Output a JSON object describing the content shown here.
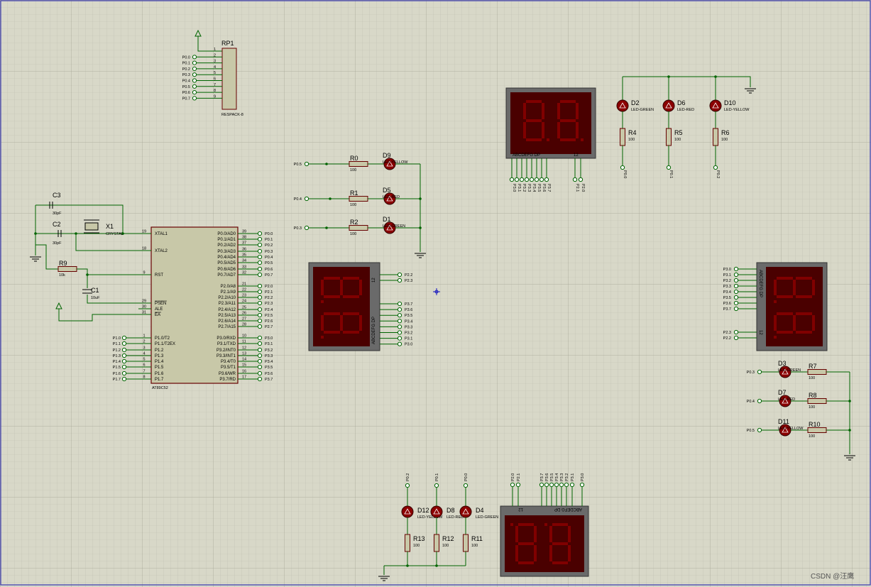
{
  "schematic": {
    "mcu": {
      "ref": "AT89C52",
      "left_pins": [
        {
          "num": "19",
          "name": "XTAL1"
        },
        {
          "num": "18",
          "name": "XTAL2"
        },
        {
          "num": "9",
          "name": "RST"
        },
        {
          "num": "29",
          "name": "PSEN"
        },
        {
          "num": "30",
          "name": "ALE"
        },
        {
          "num": "31",
          "name": "EA"
        },
        {
          "num": "1",
          "name": "P1.0/T2"
        },
        {
          "num": "2",
          "name": "P1.1/T2EX"
        },
        {
          "num": "3",
          "name": "P1.2"
        },
        {
          "num": "4",
          "name": "P1.3"
        },
        {
          "num": "5",
          "name": "P1.4"
        },
        {
          "num": "6",
          "name": "P1.5"
        },
        {
          "num": "7",
          "name": "P1.6"
        },
        {
          "num": "8",
          "name": "P1.7"
        }
      ],
      "left_nets": [
        "P1.0",
        "P1.1",
        "P1.2",
        "P1.3",
        "P1.4",
        "P1.5",
        "P1.6",
        "P1.7"
      ],
      "right_pins": [
        {
          "num": "39",
          "name": "P0.0/AD0",
          "net": "P0.0"
        },
        {
          "num": "38",
          "name": "P0.1/AD1",
          "net": "P0.1"
        },
        {
          "num": "37",
          "name": "P0.2/AD2",
          "net": "P0.2"
        },
        {
          "num": "36",
          "name": "P0.3/AD3",
          "net": "P0.3"
        },
        {
          "num": "35",
          "name": "P0.4/AD4",
          "net": "P0.4"
        },
        {
          "num": "34",
          "name": "P0.5/AD5",
          "net": "P0.5"
        },
        {
          "num": "33",
          "name": "P0.6/AD6",
          "net": "P0.6"
        },
        {
          "num": "32",
          "name": "P0.7/AD7",
          "net": "P0.7"
        },
        {
          "num": "21",
          "name": "P2.0/A8",
          "net": "P2.0"
        },
        {
          "num": "22",
          "name": "P2.1/A9",
          "net": "P2.1"
        },
        {
          "num": "23",
          "name": "P2.2/A10",
          "net": "P2.2"
        },
        {
          "num": "24",
          "name": "P2.3/A11",
          "net": "P2.3"
        },
        {
          "num": "25",
          "name": "P2.4/A12",
          "net": "P2.4"
        },
        {
          "num": "26",
          "name": "P2.5/A13",
          "net": "P2.5"
        },
        {
          "num": "27",
          "name": "P2.6/A14",
          "net": "P2.6"
        },
        {
          "num": "28",
          "name": "P2.7/A15",
          "net": "P2.7"
        },
        {
          "num": "10",
          "name": "P3.0/RXD",
          "net": "P3.0"
        },
        {
          "num": "11",
          "name": "P3.1/TXD",
          "net": "P3.1"
        },
        {
          "num": "12",
          "name": "P3.2/INT0",
          "net": "P3.2"
        },
        {
          "num": "13",
          "name": "P3.3/INT1",
          "net": "P3.3"
        },
        {
          "num": "14",
          "name": "P3.4/T0",
          "net": "P3.4"
        },
        {
          "num": "15",
          "name": "P3.5/T1",
          "net": "P3.5"
        },
        {
          "num": "16",
          "name": "P3.6/WR",
          "net": "P3.6"
        },
        {
          "num": "17",
          "name": "P3.7/RD",
          "net": "P3.7"
        }
      ]
    },
    "rp1": {
      "ref": "RP1",
      "value": "RESPACK-8",
      "pins": [
        "1",
        "2",
        "3",
        "4",
        "5",
        "6",
        "7",
        "8",
        "9"
      ],
      "nets": [
        "P0.0",
        "P0.1",
        "P0.2",
        "P0.3",
        "P0.4",
        "P0.5",
        "P0.6",
        "P0.7"
      ]
    },
    "crystal": {
      "ref": "X1",
      "value": "CRYSTAL"
    },
    "c3": {
      "ref": "C3",
      "value": "30pF"
    },
    "c2": {
      "ref": "C2",
      "value": "30pF"
    },
    "c1": {
      "ref": "C1",
      "value": "10uF"
    },
    "r9": {
      "ref": "R9",
      "value": "10k"
    },
    "led_group_1": [
      {
        "net": "P0.5",
        "rref": "R0",
        "rval": "100",
        "dref": "D9",
        "dval": "LED-YELLOW"
      },
      {
        "net": "P0.4",
        "rref": "R1",
        "rval": "100",
        "dref": "D5",
        "dval": "LED-RED"
      },
      {
        "net": "P0.3",
        "rref": "R2",
        "rval": "100",
        "dref": "D1",
        "dval": "LED-GREEN"
      }
    ],
    "led_group_2": [
      {
        "net": "P0.0",
        "rref": "R4",
        "rval": "100",
        "dref": "D2",
        "dval": "LED-GREEN"
      },
      {
        "net": "P0.1",
        "rref": "R5",
        "rval": "100",
        "dref": "D6",
        "dval": "LED-RED"
      },
      {
        "net": "P0.2",
        "rref": "R6",
        "rval": "100",
        "dref": "D10",
        "dval": "LED-YELLOW"
      }
    ],
    "led_group_3": [
      {
        "net": "P0.3",
        "rref": "R7",
        "rval": "100",
        "dref": "D3",
        "dval": "LED-GREEN"
      },
      {
        "net": "P0.4",
        "rref": "R8",
        "rval": "100",
        "dref": "D7",
        "dval": "LED-RED"
      },
      {
        "net": "P0.5",
        "rref": "R10",
        "rval": "100",
        "dref": "D11",
        "dval": "LED-YELLOW"
      }
    ],
    "led_group_4": [
      {
        "net": "P0.2",
        "rref": "R13",
        "rval": "100",
        "dref": "D12",
        "dval": "LED-YELLOW"
      },
      {
        "net": "P0.1",
        "rref": "R12",
        "rval": "100",
        "dref": "D8",
        "dval": "LED-RED"
      },
      {
        "net": "P0.0",
        "rref": "R11",
        "rval": "100",
        "dref": "D4",
        "dval": "LED-GREEN"
      }
    ],
    "seg_top": {
      "label": "ABCDEFG  DP",
      "digits": "12",
      "nets": [
        "P3.0",
        "P3.1",
        "P3.2",
        "P3.3",
        "P3.4",
        "P3.5",
        "P3.6",
        "P3.7",
        "P2.1",
        "P2.0"
      ]
    },
    "seg_left": {
      "label": "ABCDEFG  DP",
      "digits": "12",
      "digit_nets": [
        "P2.2",
        "P2.3"
      ],
      "seg_nets": [
        "P3.7",
        "P3.6",
        "P3.5",
        "P3.4",
        "P3.3",
        "P3.2",
        "P3.1",
        "P3.0"
      ]
    },
    "seg_right": {
      "label": "ABCDEFG  DP",
      "digits": "12",
      "seg_nets": [
        "P3.0",
        "P3.1",
        "P3.2",
        "P3.3",
        "P3.4",
        "P3.5",
        "P3.6",
        "P3.7"
      ],
      "digit_nets": [
        "P2.3",
        "P2.2"
      ]
    },
    "seg_bottom": {
      "label": "ABCDEFG  DP",
      "digits": "12",
      "nets": [
        "P2.0",
        "P2.1",
        "P3.7",
        "P3.6",
        "P3.5",
        "P3.4",
        "P3.3",
        "P3.2",
        "P3.1",
        "P3.0"
      ]
    },
    "watermark": "CSDN @汪鹰",
    "colors": {
      "background": "#d8d8c8",
      "wire": "#006400",
      "body": "#c8c8a8",
      "display_bg": "#4a0000",
      "segment": "#800000",
      "led": "#8b0000"
    }
  }
}
